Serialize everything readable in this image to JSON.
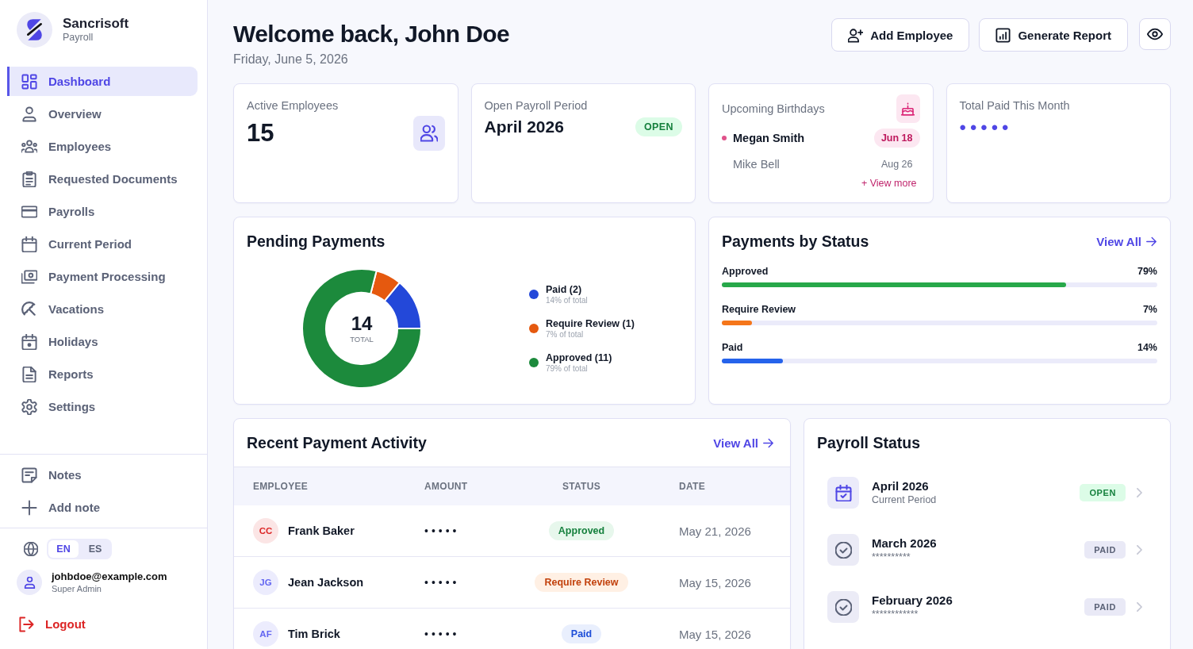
{
  "sidebar": {
    "brand": {
      "name": "Sancrisoft",
      "subtitle": "Payroll"
    },
    "nav": [
      {
        "label": "Dashboard",
        "selected": true
      },
      {
        "label": "Overview",
        "selected": false
      },
      {
        "label": "Employees",
        "selected": false
      },
      {
        "label": "Requested Documents",
        "selected": false
      },
      {
        "label": "Payrolls",
        "selected": false
      },
      {
        "label": "Current Period",
        "selected": false
      },
      {
        "label": "Payment Processing",
        "selected": false
      },
      {
        "label": "Vacations",
        "selected": false
      },
      {
        "label": "Holidays",
        "selected": false
      },
      {
        "label": "Reports",
        "selected": false
      },
      {
        "label": "Settings",
        "selected": false
      }
    ],
    "notes": [
      {
        "label": "Notes"
      },
      {
        "label": "Add note"
      }
    ],
    "languages": [
      {
        "label": "EN",
        "selected": true
      },
      {
        "label": "ES",
        "selected": false
      }
    ],
    "user": {
      "email": "johbdoe@example.com",
      "role": "Super Admin"
    },
    "logout": "Logout"
  },
  "header": {
    "title": "Welcome back, John Doe",
    "date": "Friday, June 5, 2026",
    "buttons": [
      {
        "label": "Add Employee"
      },
      {
        "label": "Generate Report"
      }
    ]
  },
  "active_employees": {
    "label": "Active Employees",
    "value": "15"
  },
  "open_payroll_period": {
    "label": "Open Payroll Period",
    "value": "April 2026",
    "badge": "OPEN"
  },
  "upcoming_birthdays": {
    "label": "Upcoming Birthdays",
    "people": [
      {
        "name": "Megan Smith",
        "date": "Jun 18",
        "highlighted": true
      },
      {
        "name": "Mike Bell",
        "date": "Aug 26",
        "highlighted": false
      }
    ],
    "link": "+ View more"
  },
  "total_paid_this_month": {
    "label": "Total Paid This Month",
    "value": "•••••"
  },
  "pending_payments": {
    "title": "Pending Payments",
    "center_value": "14",
    "center_label": "TOTAL",
    "chart_data": {
      "type": "donut",
      "categories": [
        "Paid (2)",
        "Require Review (1)",
        "Approved (11)"
      ],
      "values": [
        14,
        7,
        79
      ]
    },
    "legend": [
      {
        "share": "14% of total",
        "color": "#2348d9"
      },
      {
        "share": "7% of total",
        "color": "#e5590f"
      },
      {
        "share": "79% of total",
        "color": "#1c8a3c"
      }
    ]
  },
  "payments_by_status": {
    "title": "Payments by Status",
    "link": "View All",
    "bars": [
      {
        "label": "Approved",
        "reading": "79%",
        "level": 0.79,
        "color": "#27a84a"
      },
      {
        "label": "Require Review",
        "reading": "7%",
        "level": 0.07,
        "color": "#f5761a"
      },
      {
        "label": "Paid",
        "reading": "14%",
        "level": 0.14,
        "color": "#2563eb"
      }
    ]
  },
  "recent_payment_activity": {
    "title": "Recent Payment Activity",
    "link": "View All",
    "columns": [
      "EMPLOYEE",
      "AMOUNT",
      "STATUS",
      "DATE"
    ],
    "rows": [
      {
        "initials": "CC",
        "color": "#dc2626",
        "employee": "Frank Baker",
        "amount": "•••••",
        "status": "Approved",
        "kind": "approved",
        "date": "May 21, 2026"
      },
      {
        "initials": "JG",
        "color": "#6366f1",
        "employee": "Jean Jackson",
        "amount": "•••••",
        "status": "Require Review",
        "kind": "review",
        "date": "May 15, 2026"
      },
      {
        "initials": "AF",
        "color": "#6366f1",
        "employee": "Tim Brick",
        "amount": "•••••",
        "status": "Paid",
        "kind": "paid",
        "date": "May 15, 2026"
      }
    ]
  },
  "payroll_status": {
    "title": "Payroll Status",
    "periods": [
      {
        "title": "April 2026",
        "subtitle": "Current Period",
        "badge": "OPEN",
        "kind": "open"
      },
      {
        "title": "March 2026",
        "subtitle": "**********",
        "badge": "PAID",
        "kind": "paid"
      },
      {
        "title": "February 2026",
        "subtitle": "************",
        "badge": "PAID",
        "kind": "paid"
      }
    ]
  }
}
